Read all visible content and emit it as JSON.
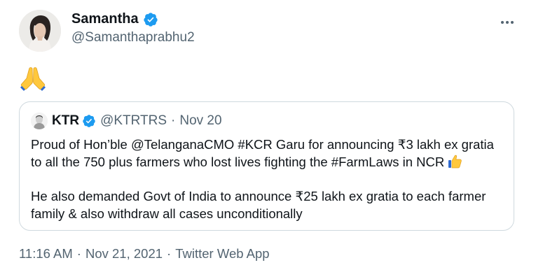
{
  "author": {
    "name": "Samantha",
    "handle": "@Samanthaprabhu2",
    "avatar_icon": "profile-photo",
    "verified_icon": "verified-badge-icon",
    "verified_color": "#1d9bf0"
  },
  "tweet": {
    "emoji_icon": "folded-hands-emoji",
    "emoji_color": "#ffc83d"
  },
  "quoted": {
    "name": "KTR",
    "handle": "@KTRTRS",
    "dot": "·",
    "date": "Nov 20",
    "line1": "Proud of Hon’ble @TelanganaCMO #KCR Garu for announcing ₹3 lakh ex gratia",
    "line2": "to all the 750 plus farmers who lost lives fighting the #FarmLaws in NCR",
    "line3": "He also demanded Govt of India to announce ₹25 lakh ex gratia to each farmer",
    "line4": "family & also withdraw all cases unconditionally",
    "thumb_icon": "thumbs-up-emoji"
  },
  "meta": {
    "time": "11:16 AM",
    "dot": "·",
    "date": "Nov 21, 2021",
    "dot2": "·",
    "source": "Twitter Web App"
  },
  "colors": {
    "text_primary": "#0f1419",
    "text_secondary": "#536471",
    "border": "#cfd9de"
  }
}
